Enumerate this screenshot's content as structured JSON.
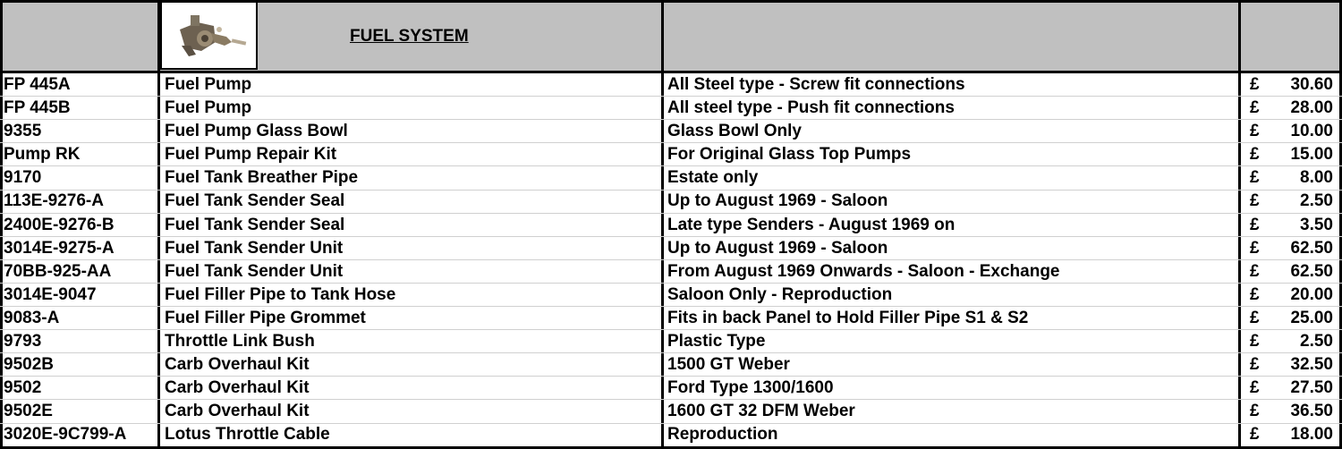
{
  "header": {
    "title": "FUEL SYSTEM",
    "image": "fuel-pump-photo"
  },
  "columns": [
    "code",
    "name",
    "description",
    "currency",
    "price"
  ],
  "rows": [
    {
      "code": "FP 445A",
      "name": "Fuel Pump",
      "description": "All Steel type - Screw fit connections",
      "currency": "£",
      "price": "30.60"
    },
    {
      "code": "FP 445B",
      "name": "Fuel Pump",
      "description": "All steel type - Push fit connections",
      "currency": "£",
      "price": "28.00"
    },
    {
      "code": "9355",
      "name": "Fuel Pump Glass Bowl",
      "description": "Glass Bowl Only",
      "currency": "£",
      "price": "10.00"
    },
    {
      "code": "Pump RK",
      "name": "Fuel Pump Repair Kit",
      "description": "For Original Glass Top Pumps",
      "currency": "£",
      "price": "15.00"
    },
    {
      "code": "9170",
      "name": "Fuel Tank Breather Pipe",
      "description": "Estate only",
      "currency": "£",
      "price": "8.00"
    },
    {
      "code": "113E-9276-A",
      "name": "Fuel Tank Sender Seal",
      "description": "Up to August 1969 - Saloon",
      "currency": "£",
      "price": "2.50"
    },
    {
      "code": "2400E-9276-B",
      "name": "Fuel Tank Sender Seal",
      "description": "Late type Senders - August 1969 on",
      "currency": "£",
      "price": "3.50"
    },
    {
      "code": "3014E-9275-A",
      "name": "Fuel Tank Sender Unit",
      "description": "Up to August 1969 - Saloon",
      "currency": "£",
      "price": "62.50"
    },
    {
      "code": "70BB-925-AA",
      "name": "Fuel Tank Sender Unit",
      "description": "From August 1969 Onwards - Saloon - Exchange",
      "currency": "£",
      "price": "62.50"
    },
    {
      "code": "3014E-9047",
      "name": "Fuel Filler Pipe to Tank Hose",
      "description": "Saloon Only - Reproduction",
      "currency": "£",
      "price": "20.00"
    },
    {
      "code": "9083-A",
      "name": "Fuel Filler Pipe Grommet",
      "description": "Fits in back Panel to Hold Filler Pipe S1 & S2",
      "currency": "£",
      "price": "25.00"
    },
    {
      "code": "9793",
      "name": "Throttle Link Bush",
      "description": "Plastic Type",
      "currency": "£",
      "price": "2.50"
    },
    {
      "code": "9502B",
      "name": "Carb Overhaul Kit",
      "description": "1500 GT Weber",
      "currency": "£",
      "price": "32.50"
    },
    {
      "code": "9502",
      "name": "Carb Overhaul Kit",
      "description": "Ford Type 1300/1600",
      "currency": "£",
      "price": "27.50"
    },
    {
      "code": "9502E",
      "name": "Carb Overhaul Kit",
      "description": "1600 GT 32 DFM Weber",
      "currency": "£",
      "price": "36.50"
    },
    {
      "code": "3020E-9C799-A",
      "name": "Lotus Throttle Cable",
      "description": "Reproduction",
      "currency": "£",
      "price": "18.00"
    }
  ]
}
